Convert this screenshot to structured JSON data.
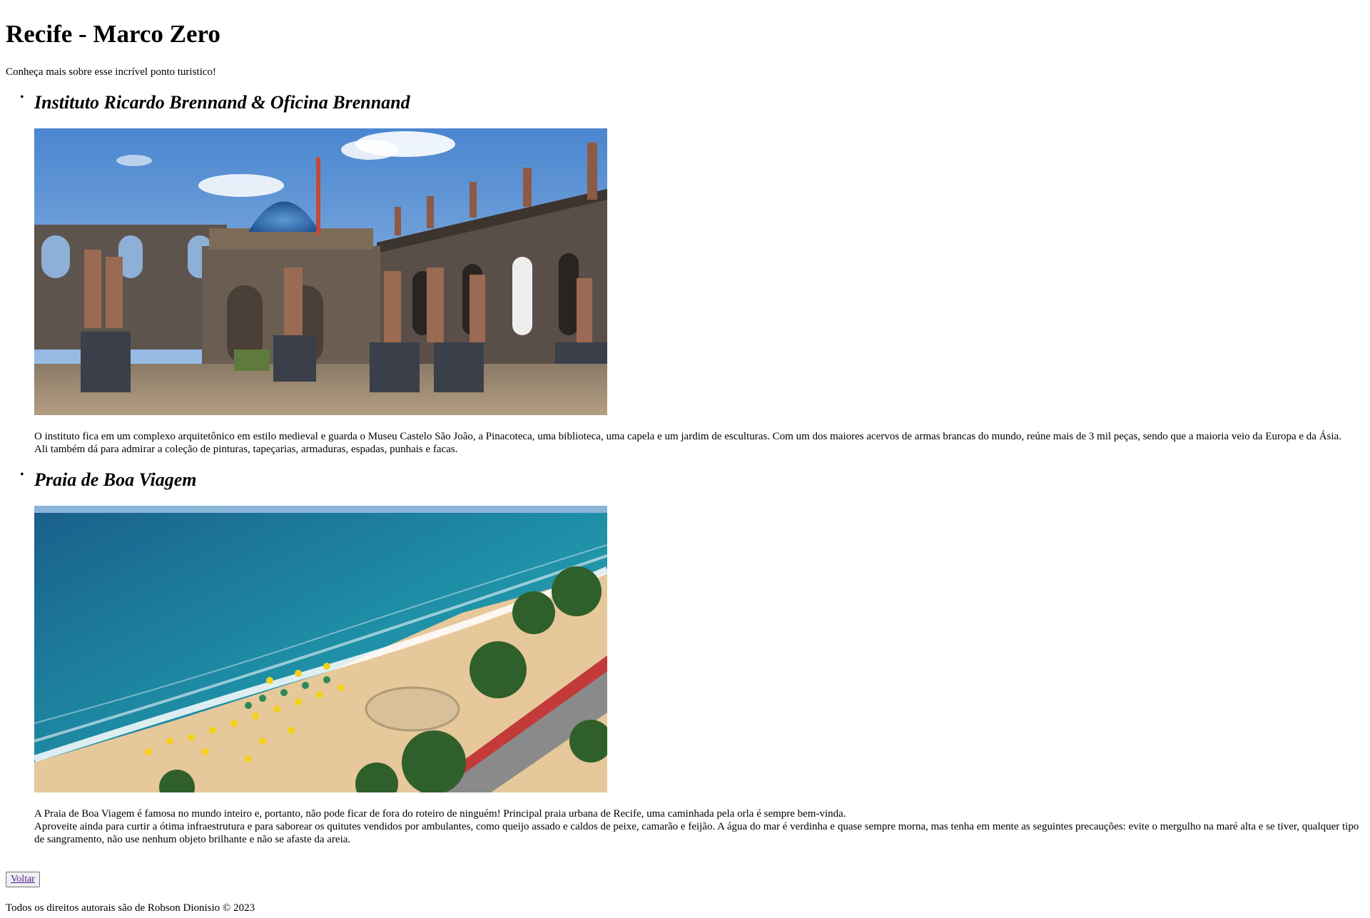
{
  "page": {
    "title": "Recife - Marco Zero",
    "subtitle": "Conheça mais sobre esse incrível ponto turistico!"
  },
  "places": [
    {
      "title": "Instituto Ricardo Brennand & Oficina Brennand",
      "image_icon": "castle-photo",
      "paragraph1": "O instituto fica em um complexo arquitetônico em estilo medieval e guarda o Museu Castelo São João, a Pinacoteca, uma biblioteca, uma capela e um jardim de esculturas. Com um dos maiores acervos de armas brancas do mundo, reúne mais de 3 mil peças, sendo que a maioria veio da Europa e da Ásia.",
      "paragraph2": "Ali também dá para admirar a coleção de pinturas, tapeçarias, armaduras, espadas, punhais e facas."
    },
    {
      "title": "Praia de Boa Viagem",
      "image_icon": "beach-photo",
      "paragraph1": "A Praia de Boa Viagem é famosa no mundo inteiro e, portanto, não pode ficar de fora do roteiro de ninguém! Principal praia urbana de Recife, uma caminhada pela orla é sempre bem-vinda.",
      "paragraph2": "Aproveite ainda para curtir a ótima infraestrutura e para saborear os quitutes vendidos por ambulantes, como queijo assado e caldos de peixe, camarão e feijão. A água do mar é verdinha e quase sempre morna, mas tenha em mente as seguintes precauções: evite o mergulho na maré alta e se tiver, qualquer tipo de sangramento, não use nenhum objeto brilhante e não se afaste da areia."
    }
  ],
  "back_button": {
    "label": "Voltar"
  },
  "footer": {
    "text": "Todos os direitos autorais são de Robson Dionisio © 2023"
  }
}
